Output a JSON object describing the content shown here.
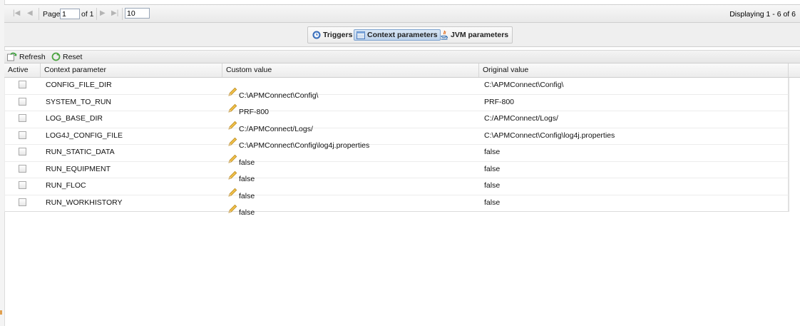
{
  "pager": {
    "page_label": "Page",
    "page_value": "1",
    "of_label": "of 1",
    "page_size": "10",
    "display_info": "Displaying 1 - 6 of 6",
    "first_icon": "first-page-icon",
    "prev_icon": "prev-page-icon",
    "next_icon": "next-page-icon",
    "last_icon": "last-page-icon"
  },
  "tabs": [
    {
      "label": "Triggers",
      "icon": "clock-icon",
      "active": false
    },
    {
      "label": "Context parameters",
      "icon": "table-icon",
      "active": true
    },
    {
      "label": "JVM parameters",
      "icon": "java-icon",
      "active": false
    }
  ],
  "toolbar": {
    "refresh_label": "Refresh",
    "reset_label": "Reset"
  },
  "columns": {
    "active": "Active",
    "param": "Context parameter",
    "custom": "Custom value",
    "original": "Original value"
  },
  "rows": [
    {
      "param": "CONFIG_FILE_DIR",
      "custom": "C:\\APMConnect\\Config\\",
      "original": "C:\\APMConnect\\Config\\"
    },
    {
      "param": "SYSTEM_TO_RUN",
      "custom": "PRF-800",
      "original": "PRF-800"
    },
    {
      "param": "LOG_BASE_DIR",
      "custom": "C:/APMConnect/Logs/",
      "original": "C:/APMConnect/Logs/"
    },
    {
      "param": "LOG4J_CONFIG_FILE",
      "custom": "C:\\APMConnect\\Config\\log4j.properties",
      "original": "C:\\APMConnect\\Config\\log4j.properties"
    },
    {
      "param": "RUN_STATIC_DATA",
      "custom": "false",
      "original": "false"
    },
    {
      "param": "RUN_EQUIPMENT",
      "custom": "false",
      "original": "false"
    },
    {
      "param": "RUN_FLOC",
      "custom": "false",
      "original": "false"
    },
    {
      "param": "RUN_WORKHISTORY",
      "custom": "false",
      "original": "false"
    }
  ],
  "colors": {
    "active_tab_fill": "#bdd3ec",
    "active_tab_border": "#7fa4cf",
    "pencil": "#e8b53c"
  }
}
